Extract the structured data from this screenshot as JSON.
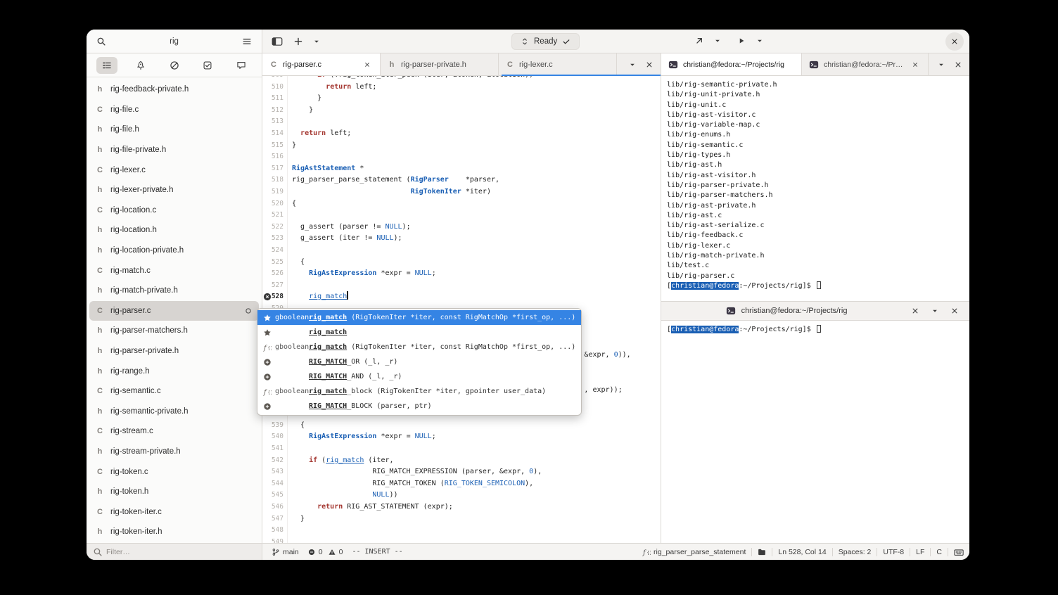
{
  "sidebar": {
    "search_value": "rig",
    "filter_placeholder": "Filter…",
    "rail": [
      {
        "icon": "r_list",
        "name": "symbols",
        "active": true
      },
      {
        "icon": "r_rocket",
        "name": "build"
      },
      {
        "icon": "r_ban",
        "name": "diagnostics"
      },
      {
        "icon": "r_todo",
        "name": "todo"
      },
      {
        "icon": "r_chat",
        "name": "messages"
      }
    ],
    "files": [
      {
        "icon": "h",
        "name": "rig-feedback-private.h"
      },
      {
        "icon": "C",
        "name": "rig-file.c"
      },
      {
        "icon": "h",
        "name": "rig-file.h"
      },
      {
        "icon": "h",
        "name": "rig-file-private.h"
      },
      {
        "icon": "C",
        "name": "rig-lexer.c"
      },
      {
        "icon": "h",
        "name": "rig-lexer-private.h"
      },
      {
        "icon": "C",
        "name": "rig-location.c"
      },
      {
        "icon": "h",
        "name": "rig-location.h"
      },
      {
        "icon": "h",
        "name": "rig-location-private.h"
      },
      {
        "icon": "C",
        "name": "rig-match.c"
      },
      {
        "icon": "h",
        "name": "rig-match-private.h"
      },
      {
        "icon": "C",
        "name": "rig-parser.c",
        "selected": true,
        "modified": true
      },
      {
        "icon": "h",
        "name": "rig-parser-matchers.h"
      },
      {
        "icon": "h",
        "name": "rig-parser-private.h"
      },
      {
        "icon": "h",
        "name": "rig-range.h"
      },
      {
        "icon": "C",
        "name": "rig-semantic.c"
      },
      {
        "icon": "h",
        "name": "rig-semantic-private.h"
      },
      {
        "icon": "C",
        "name": "rig-stream.c"
      },
      {
        "icon": "h",
        "name": "rig-stream-private.h"
      },
      {
        "icon": "C",
        "name": "rig-token.c"
      },
      {
        "icon": "h",
        "name": "rig-token.h"
      },
      {
        "icon": "C",
        "name": "rig-token-iter.c"
      },
      {
        "icon": "h",
        "name": "rig-token-iter.h"
      }
    ]
  },
  "header": {
    "omnibar_label": "Ready"
  },
  "editor": {
    "tabs": [
      {
        "icon": "C",
        "label": "rig-parser.c",
        "active": true,
        "closable": true
      },
      {
        "icon": "h",
        "label": "rig-parser-private.h"
      },
      {
        "icon": "C",
        "label": "rig-lexer.c"
      }
    ],
    "lines": [
      {
        "n": 509,
        "p": [
          [
            "      ",
            ""
          ],
          [
            "if",
            "k"
          ],
          [
            " (!rig_token_iter_peek (iter, &token, &location))",
            ""
          ]
        ]
      },
      {
        "n": 510,
        "p": [
          [
            "        ",
            ""
          ],
          [
            "return",
            "k"
          ],
          [
            " left;",
            ""
          ]
        ]
      },
      {
        "n": 511,
        "p": [
          [
            "      }",
            ""
          ]
        ]
      },
      {
        "n": 512,
        "p": [
          [
            "    }",
            ""
          ]
        ]
      },
      {
        "n": 513,
        "p": []
      },
      {
        "n": 514,
        "p": [
          [
            "  ",
            ""
          ],
          [
            "return",
            "k"
          ],
          [
            " left;",
            ""
          ]
        ]
      },
      {
        "n": 515,
        "p": [
          [
            "}",
            ""
          ]
        ]
      },
      {
        "n": 516,
        "p": []
      },
      {
        "n": 517,
        "p": [
          [
            "RigAstStatement",
            "t"
          ],
          [
            " *",
            ""
          ]
        ]
      },
      {
        "n": 518,
        "p": [
          [
            "rig_parser_parse_statement (",
            ""
          ],
          [
            "RigParser",
            "t"
          ],
          [
            "    *parser,",
            ""
          ]
        ]
      },
      {
        "n": 519,
        "p": [
          [
            "                            ",
            ""
          ],
          [
            "RigTokenIter",
            "t"
          ],
          [
            " *iter)",
            ""
          ]
        ]
      },
      {
        "n": 520,
        "p": [
          [
            "{",
            ""
          ]
        ]
      },
      {
        "n": 521,
        "p": []
      },
      {
        "n": 522,
        "p": [
          [
            "  g_assert (parser != ",
            ""
          ],
          [
            "NULL",
            "c"
          ],
          [
            ");",
            ""
          ]
        ]
      },
      {
        "n": 523,
        "p": [
          [
            "  g_assert (iter != ",
            ""
          ],
          [
            "NULL",
            "c"
          ],
          [
            ");",
            ""
          ]
        ]
      },
      {
        "n": 524,
        "p": []
      },
      {
        "n": 525,
        "p": [
          [
            "  {",
            ""
          ]
        ]
      },
      {
        "n": 526,
        "p": [
          [
            "    ",
            ""
          ],
          [
            "RigAstExpression",
            "t"
          ],
          [
            " *expr = ",
            ""
          ],
          [
            "NULL",
            "c"
          ],
          [
            ";",
            ""
          ]
        ]
      },
      {
        "n": 527,
        "p": []
      },
      {
        "n": 528,
        "p": [
          [
            "    ",
            ""
          ],
          [
            "rig_match",
            "u"
          ]
        ],
        "cursor": true,
        "mark": true
      },
      {
        "n": 529,
        "p": []
      },
      {
        "n": 530,
        "p": []
      },
      {
        "n": 531,
        "p": []
      },
      {
        "n": 532,
        "p": []
      },
      {
        "n": 533,
        "p": [
          [
            "                                                                     ",
            ""
          ],
          [
            "&expr, ",
            ""
          ],
          [
            "0",
            "c"
          ],
          [
            ")),",
            ""
          ]
        ]
      },
      {
        "n": 534,
        "p": []
      },
      {
        "n": 535,
        "p": []
      },
      {
        "n": 536,
        "p": [
          [
            "                                                                     ",
            ""
          ],
          [
            ", expr));",
            ""
          ]
        ]
      },
      {
        "n": 537,
        "p": []
      },
      {
        "n": 538,
        "p": []
      },
      {
        "n": 539,
        "p": [
          [
            "  {",
            ""
          ]
        ]
      },
      {
        "n": 540,
        "p": [
          [
            "    ",
            ""
          ],
          [
            "RigAstExpression",
            "t"
          ],
          [
            " *expr = ",
            ""
          ],
          [
            "NULL",
            "c"
          ],
          [
            ";",
            ""
          ]
        ]
      },
      {
        "n": 541,
        "p": []
      },
      {
        "n": 542,
        "p": [
          [
            "    ",
            ""
          ],
          [
            "if",
            "k"
          ],
          [
            " (",
            ""
          ],
          [
            "rig_match",
            "u"
          ],
          [
            " (iter,",
            ""
          ]
        ]
      },
      {
        "n": 543,
        "p": [
          [
            "                   RIG_MATCH_EXPRESSION (parser, &expr, ",
            ""
          ],
          [
            "0",
            "c"
          ],
          [
            "),",
            ""
          ]
        ]
      },
      {
        "n": 544,
        "p": [
          [
            "                   RIG_MATCH_TOKEN (",
            ""
          ],
          [
            "RIG_TOKEN_SEMICOLON",
            "c"
          ],
          [
            "),",
            ""
          ]
        ]
      },
      {
        "n": 545,
        "p": [
          [
            "                   ",
            ""
          ],
          [
            "NULL",
            "c"
          ],
          [
            "))",
            ""
          ]
        ]
      },
      {
        "n": 546,
        "p": [
          [
            "      ",
            ""
          ],
          [
            "return",
            "k"
          ],
          [
            " RIG_AST_STATEMENT (expr);",
            ""
          ]
        ]
      },
      {
        "n": 547,
        "p": [
          [
            "  }",
            ""
          ]
        ]
      },
      {
        "n": 548,
        "p": []
      },
      {
        "n": 549,
        "p": []
      }
    ]
  },
  "completion": {
    "rows": [
      {
        "icon": "star",
        "ret": "gboolean",
        "selected": true,
        "parts": [
          {
            "t": "rig_match",
            "m": true
          },
          {
            "t": " (RigTokenIter *iter, const RigMatchOp *first_op, ...)"
          }
        ]
      },
      {
        "icon": "star",
        "ret": "",
        "parts": [
          {
            "t": "rig_match",
            "m": true
          }
        ]
      },
      {
        "icon": "fn",
        "ret": "gboolean",
        "parts": [
          {
            "t": "rig_match",
            "m": true
          },
          {
            "t": " (RigTokenIter *iter, const RigMatchOp *first_op, ...)"
          }
        ]
      },
      {
        "icon": "macro",
        "ret": "",
        "parts": [
          {
            "t": "RIG_MATCH",
            "m": true
          },
          {
            "t": "_OR (_l, _r)"
          }
        ]
      },
      {
        "icon": "macro",
        "ret": "",
        "parts": [
          {
            "t": "RIG_MATCH",
            "m": true
          },
          {
            "t": "_AND (_l, _r)"
          }
        ]
      },
      {
        "icon": "fn",
        "ret": "gboolean",
        "parts": [
          {
            "t": "rig_match",
            "m": true
          },
          {
            "t": "_block (RigTokenIter *iter, gpointer user_data)"
          }
        ]
      },
      {
        "icon": "macro",
        "ret": "",
        "parts": [
          {
            "t": "RIG_MATCH",
            "m": true
          },
          {
            "t": "_BLOCK (parser, ptr)"
          }
        ]
      }
    ]
  },
  "terminals": {
    "tabs": [
      {
        "label": "christian@fedora:~/Projects/rig",
        "active": true
      },
      {
        "label": "christian@fedora:~/Projects",
        "closable": true
      }
    ],
    "pane1_lines": [
      "lib/rig-semantic-private.h",
      "lib/rig-unit-private.h",
      "lib/rig-unit.c",
      "lib/rig-ast-visitor.c",
      "lib/rig-variable-map.c",
      "lib/rig-enums.h",
      "lib/rig-semantic.c",
      "lib/rig-types.h",
      "lib/rig-ast.h",
      "lib/rig-ast-visitor.h",
      "lib/rig-parser-private.h",
      "lib/rig-parser-matchers.h",
      "lib/rig-ast-private.h",
      "lib/rig-ast.c",
      "lib/rig-ast-serialize.c",
      "lib/rig-feedback.c",
      "lib/rig-lexer.c",
      "lib/rig-match-private.h",
      "lib/test.c",
      "lib/rig-parser.c"
    ],
    "prompt": {
      "prefix": "[",
      "user": "christian@fedora",
      "suffix": ":~/Projects/rig]$ "
    },
    "pane2_title": "christian@fedora:~/Projects/rig"
  },
  "statusbar": {
    "branch": "main",
    "errors": "0",
    "warnings": "0",
    "mode": "-- INSERT --",
    "symbol": "rig_parser_parse_statement",
    "position": "Ln 528, Col 14",
    "spaces": "Spaces: 2",
    "encoding": "UTF-8",
    "eol": "LF",
    "lang": "C"
  },
  "colors": {
    "accent": "#3584e4",
    "selection": "#1a5fb4",
    "keyword": "#a43731",
    "type": "#1a5fb4"
  }
}
